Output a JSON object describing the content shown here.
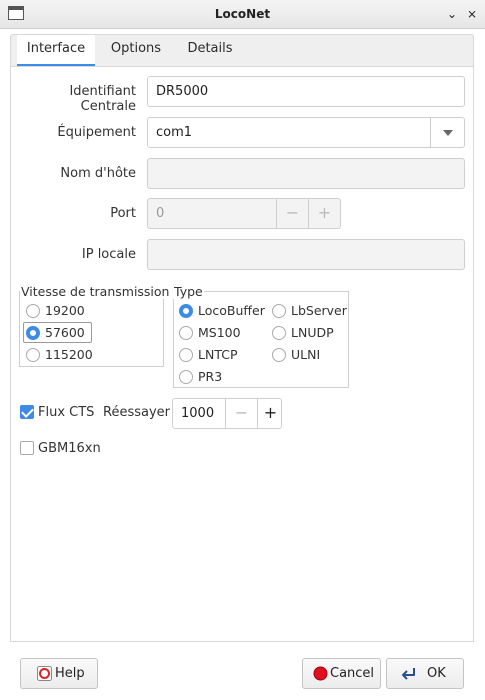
{
  "window": {
    "title": "LocoNet",
    "min_glyph": "⌄",
    "close_glyph": "⨯"
  },
  "tabs": [
    {
      "label": "Interface",
      "active": true
    },
    {
      "label": "Options",
      "active": false
    },
    {
      "label": "Details",
      "active": false
    }
  ],
  "form": {
    "id_label": "Identifiant Centrale",
    "id_value": "DR5000",
    "equip_label": "Équipement",
    "equip_value": "com1",
    "host_label": "Nom d'hôte",
    "host_value": "",
    "port_label": "Port",
    "port_value": "0",
    "ip_label": "IP locale",
    "ip_value": ""
  },
  "baud": {
    "title": "Vitesse de transmission",
    "options": [
      "19200",
      "57600",
      "115200"
    ],
    "selected": "57600"
  },
  "type": {
    "title": "Type",
    "options": [
      "LocoBuffer",
      "LbServer",
      "MS100",
      "LNUDP",
      "LNTCP",
      "ULNI",
      "PR3"
    ],
    "selected": "LocoBuffer"
  },
  "flux": {
    "label": "Flux CTS",
    "checked": true
  },
  "retry": {
    "label": "Réessayer",
    "value": "1000"
  },
  "gbm": {
    "label": "GBM16xn",
    "checked": false
  },
  "buttons": {
    "help": "Help",
    "cancel": "Cancel",
    "ok": "OK"
  },
  "colors": {
    "accent": "#3d8be6",
    "cancel_icon": "#e01020"
  },
  "icons": [
    "window-menu-icon",
    "minimize-icon",
    "close-icon",
    "chevron-down-icon",
    "help-icon",
    "cancel-icon",
    "ok-arrow-icon"
  ]
}
